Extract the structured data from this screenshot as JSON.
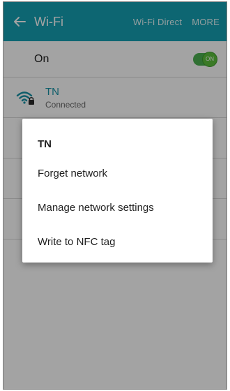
{
  "appbar": {
    "title": "Wi-Fi",
    "wifi_direct_label": "Wi-Fi Direct",
    "more_label": "MORE",
    "color": "#15a0b2"
  },
  "wifi_switch": {
    "label": "On",
    "toggle_text": "ON",
    "state": true
  },
  "networks": [
    {
      "name": "TN",
      "status": "Connected",
      "secured": true
    }
  ],
  "dialog": {
    "title": "TN",
    "items": [
      {
        "label": "Forget network"
      },
      {
        "label": "Manage network settings"
      },
      {
        "label": "Write to NFC tag"
      }
    ]
  },
  "icons": {
    "back": "arrow-left-icon",
    "wifi": "wifi-lock-icon"
  }
}
